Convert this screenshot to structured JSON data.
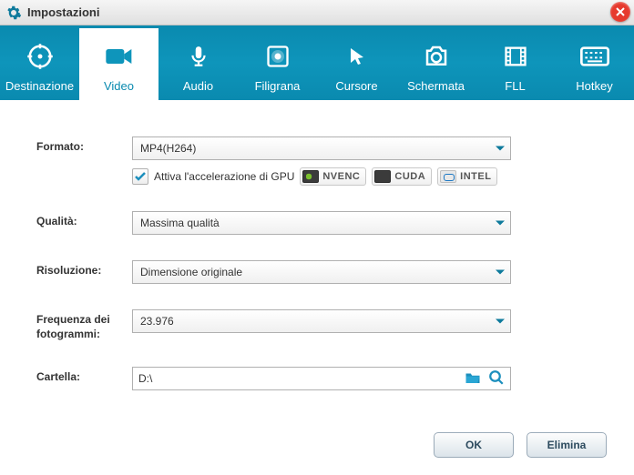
{
  "window": {
    "title": "Impostazioni"
  },
  "tabs": [
    {
      "label": "Destinazione"
    },
    {
      "label": "Video"
    },
    {
      "label": "Audio"
    },
    {
      "label": "Filigrana"
    },
    {
      "label": "Cursore"
    },
    {
      "label": "Schermata"
    },
    {
      "label": "FLL"
    },
    {
      "label": "Hotkey"
    }
  ],
  "labels": {
    "format": "Formato:",
    "quality": "Qualità:",
    "resolution": "Risoluzione:",
    "framerate": "Frequenza dei fotogrammi:",
    "folder": "Cartella:"
  },
  "values": {
    "format": "MP4(H264)",
    "quality": "Massima qualità",
    "resolution": "Dimensione originale",
    "framerate": "23.976",
    "folder": "D:\\"
  },
  "gpu": {
    "label": "Attiva l'accelerazione di GPU",
    "checked": true,
    "badges": [
      "NVENC",
      "CUDA",
      "INTEL"
    ]
  },
  "buttons": {
    "ok": "OK",
    "cancel": "Elimina"
  }
}
